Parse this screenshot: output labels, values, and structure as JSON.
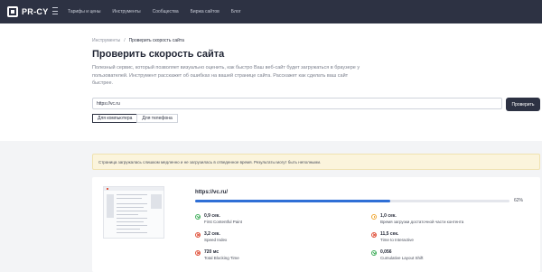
{
  "brand": {
    "logo_text": "PR-CY"
  },
  "nav": {
    "items": [
      "Тарифы и цены",
      "Инструменты",
      "Сообщества",
      "Биржа сайтов",
      "Блог"
    ]
  },
  "breadcrumb": {
    "parent": "Инструменты",
    "separator": "/",
    "current": "Проверить скорость сайта"
  },
  "page": {
    "title": "Проверить скорость сайта",
    "description": "Полезный сервис, который позволяет визуально оценить, как быстро Ваш веб-сайт будет загружаться в браузере у пользователей. Инструмент расскажет об ошибках на вашей странице сайта. Расскажет как сделать ваш сайт быстрее."
  },
  "form": {
    "url_value": "https://vc.ru",
    "submit_label": "Проверить",
    "device_tabs": [
      "Для компьютера",
      "Для телефона"
    ],
    "active_device": "Для компьютера"
  },
  "warning": {
    "text": "Страница загружалась слишком медленно и не загрузилась в отведенное время. Результаты могут быть неполными."
  },
  "result": {
    "site_url": "https://vc.ru/",
    "score_percent": 62,
    "score_label": "62%",
    "colors": {
      "good": "#3fae5a",
      "bad": "#e0543e",
      "warn": "#f0a733",
      "progress": "#2f6fd6"
    },
    "metrics": [
      {
        "value": "0,9 сек.",
        "name": "First Contentful Paint",
        "status": "good"
      },
      {
        "value": "1,0 сек.",
        "name": "Время загрузки достаточной части контента",
        "status": "warn"
      },
      {
        "value": "3,2 сек.",
        "name": "Speed Index",
        "status": "bad"
      },
      {
        "value": "11,5 сек.",
        "name": "Time to Interactive",
        "status": "bad"
      },
      {
        "value": "720 мс",
        "name": "Total Blocking Time",
        "status": "bad"
      },
      {
        "value": "0,056",
        "name": "Cumulative Layout Shift",
        "status": "good"
      }
    ]
  }
}
